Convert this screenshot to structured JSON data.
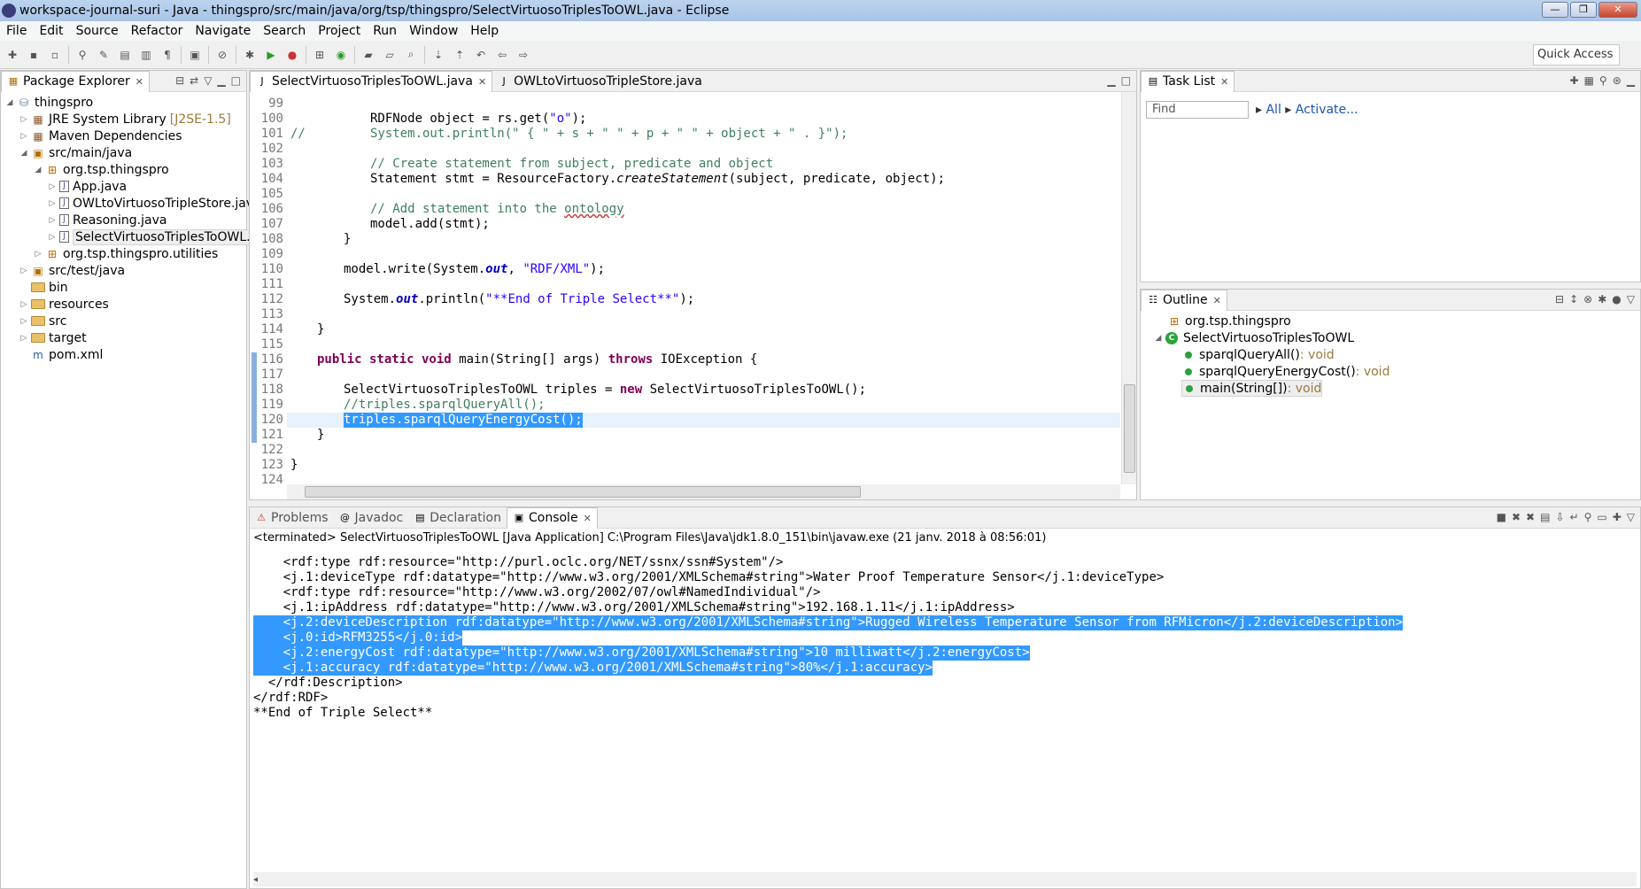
{
  "window": {
    "title": "workspace-journal-suri - Java - thingspro/src/main/java/org/tsp/thingspro/SelectVirtuosoTriplesToOWL.java - Eclipse",
    "controls": [
      "—",
      "❐",
      "✕"
    ]
  },
  "menu": [
    "File",
    "Edit",
    "Source",
    "Refactor",
    "Navigate",
    "Search",
    "Project",
    "Run",
    "Window",
    "Help"
  ],
  "toolbar": {
    "quick_access": "Quick Access"
  },
  "package_explorer": {
    "tab_label": "Package Explorer",
    "items": [
      {
        "label": "thingspro",
        "decor": ""
      },
      {
        "label": "JRE System Library",
        "decor": "[J2SE-1.5]"
      },
      {
        "label": "Maven Dependencies",
        "decor": ""
      },
      {
        "label": "src/main/java",
        "decor": ""
      },
      {
        "label": "org.tsp.thingspro",
        "decor": ""
      },
      {
        "label": "App.java",
        "decor": ""
      },
      {
        "label": "OWLtoVirtuosoTripleStore.java",
        "decor": ""
      },
      {
        "label": "Reasoning.java",
        "decor": ""
      },
      {
        "label": "SelectVirtuosoTriplesToOWL.java",
        "decor": ""
      },
      {
        "label": "org.tsp.thingspro.utilities",
        "decor": ""
      },
      {
        "label": "src/test/java",
        "decor": ""
      },
      {
        "label": "bin",
        "decor": ""
      },
      {
        "label": "resources",
        "decor": ""
      },
      {
        "label": "src",
        "decor": ""
      },
      {
        "label": "target",
        "decor": ""
      },
      {
        "label": "pom.xml",
        "decor": ""
      }
    ]
  },
  "editor": {
    "tabs": [
      {
        "label": "SelectVirtuosoTriplesToOWL.java"
      },
      {
        "label": "OWLtoVirtuosoTripleStore.java"
      }
    ],
    "lines": [
      {
        "n": "99"
      },
      {
        "n": "100"
      },
      {
        "n": "101"
      },
      {
        "n": "102"
      },
      {
        "n": "103"
      },
      {
        "n": "104"
      },
      {
        "n": "105"
      },
      {
        "n": "106"
      },
      {
        "n": "107"
      },
      {
        "n": "108"
      },
      {
        "n": "109"
      },
      {
        "n": "110"
      },
      {
        "n": "111"
      },
      {
        "n": "112"
      },
      {
        "n": "113"
      },
      {
        "n": "114"
      },
      {
        "n": "115"
      },
      {
        "n": "116"
      },
      {
        "n": "117"
      },
      {
        "n": "118"
      },
      {
        "n": "119"
      },
      {
        "n": "120"
      },
      {
        "n": "121"
      },
      {
        "n": "122"
      },
      {
        "n": "123"
      },
      {
        "n": "124"
      }
    ],
    "code": {
      "l100": "RDFNode object = rs.get(",
      "l100s": "\"o\"",
      "l100e": ");",
      "l101c": "//",
      "l101": "System.out.println(\" { \" + s + \" \" + p + \" \" + object + \" . }\");",
      "l103": "// Create statement from subject, predicate and object",
      "l104a": "Statement stmt = ResourceFactory.",
      "l104b": "createStatement",
      "l104c": "(subject, predicate, object);",
      "l106a": "// Add statement into the ",
      "l106b": "ontology",
      "l107": "model.add(stmt);",
      "l108": "}",
      "l110a": "model.write(System.",
      "l110b": "out",
      "l110c": ", ",
      "l110d": "\"RDF/XML\"",
      "l110e": ");",
      "l112a": "System.",
      "l112b": "out",
      "l112c": ".println(",
      "l112d": "\"**End of Triple Select**\"",
      "l112e": ");",
      "l114": "}",
      "l116a": "public static void",
      "l116b": " main(String[] args) ",
      "l116c": "throws",
      "l116d": " IOException {",
      "l118a": "SelectVirtuosoTriplesToOWL triples = ",
      "l118b": "new",
      "l118c": " SelectVirtuosoTriplesToOWL();",
      "l119": "//triples.sparqlQueryAll();",
      "l120": "triples.sparqlQueryEnergyCost();",
      "l121": "}",
      "l123": "}"
    }
  },
  "task_list": {
    "tab_label": "Task List",
    "find_placeholder": "Find",
    "all_link": "All",
    "activate_link": "Activate..."
  },
  "outline": {
    "tab_label": "Outline",
    "package": "org.tsp.thingspro",
    "class": "SelectVirtuosoTriplesToOWL",
    "members": [
      {
        "name": "sparqlQueryAll()",
        "ret": " : void"
      },
      {
        "name": "sparqlQueryEnergyCost()",
        "ret": " : void"
      },
      {
        "name": "main(String[])",
        "ret": " : void"
      }
    ]
  },
  "bottom": {
    "tabs": [
      "Problems",
      "Javadoc",
      "Declaration",
      "Console"
    ],
    "status": "<terminated> SelectVirtuosoTriplesToOWL [Java Application] C:\\Program Files\\Java\\jdk1.8.0_151\\bin\\javaw.exe (21 janv. 2018 à 08:56:01)",
    "lines": [
      "    <rdf:type rdf:resource=\"http://purl.oclc.org/NET/ssnx/ssn#System\"/>",
      "    <j.1:deviceType rdf:datatype=\"http://www.w3.org/2001/XMLSchema#string\">Water Proof Temperature Sensor</j.1:deviceType>",
      "    <rdf:type rdf:resource=\"http://www.w3.org/2002/07/owl#NamedIndividual\"/>",
      "    <j.1:ipAddress rdf:datatype=\"http://www.w3.org/2001/XMLSchema#string\">192.168.1.11</j.1:ipAddress>",
      "    <j.2:deviceDescription rdf:datatype=\"http://www.w3.org/2001/XMLSchema#string\">Rugged Wireless Temperature Sensor from RFMicron</j.2:deviceDescription>",
      "    <j.0:id>RFM3255</j.0:id>",
      "    <j.2:energyCost rdf:datatype=\"http://www.w3.org/2001/XMLSchema#string\">10 milliwatt</j.2:energyCost>",
      "    <j.1:accuracy rdf:datatype=\"http://www.w3.org/2001/XMLSchema#string\">80%</j.1:accuracy>",
      "  </rdf:Description>",
      "</rdf:RDF>",
      "**End of Triple Select**"
    ]
  }
}
